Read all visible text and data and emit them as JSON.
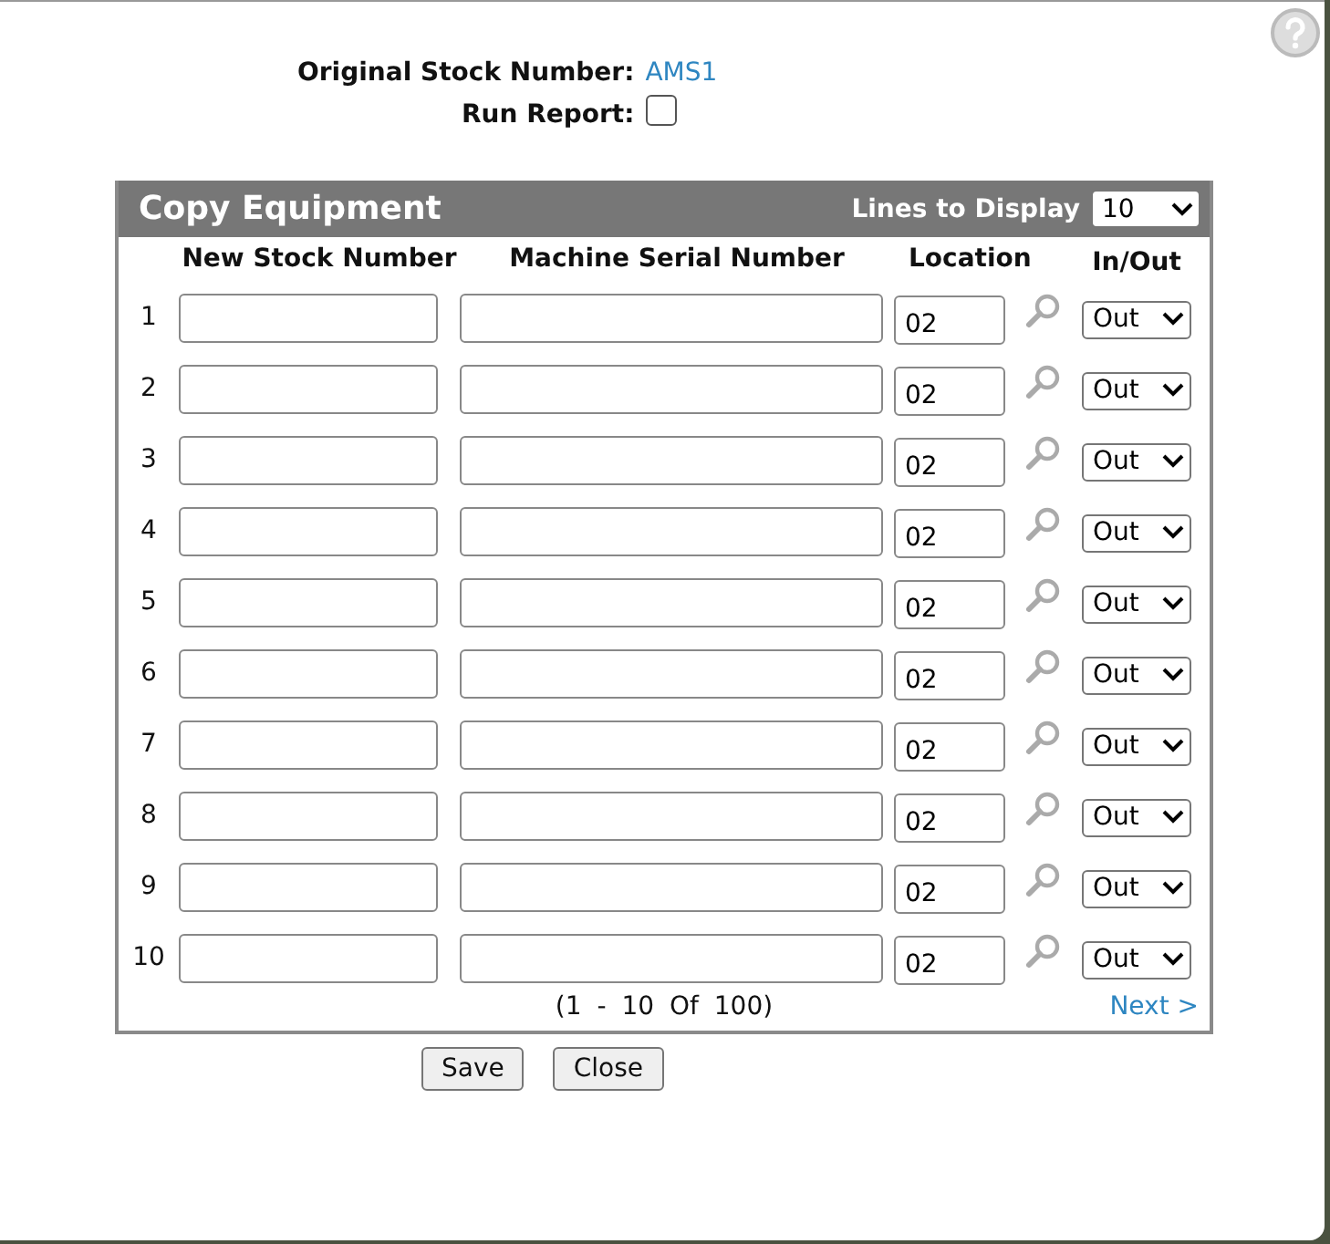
{
  "header": {
    "original_stock_label": "Original Stock Number:",
    "original_stock_value": "AMS1",
    "run_report_label": "Run Report:",
    "run_report_checked": false
  },
  "panel": {
    "title": "Copy Equipment",
    "lines_label": "Lines to Display",
    "lines_value": "10",
    "columns": [
      "New Stock Number",
      "Machine Serial Number",
      "Location",
      "In/Out"
    ],
    "rows": [
      {
        "number": "1",
        "new_stock": "",
        "serial": "",
        "location": "02",
        "in_out": "Out"
      },
      {
        "number": "2",
        "new_stock": "",
        "serial": "",
        "location": "02",
        "in_out": "Out"
      },
      {
        "number": "3",
        "new_stock": "",
        "serial": "",
        "location": "02",
        "in_out": "Out"
      },
      {
        "number": "4",
        "new_stock": "",
        "serial": "",
        "location": "02",
        "in_out": "Out"
      },
      {
        "number": "5",
        "new_stock": "",
        "serial": "",
        "location": "02",
        "in_out": "Out"
      },
      {
        "number": "6",
        "new_stock": "",
        "serial": "",
        "location": "02",
        "in_out": "Out"
      },
      {
        "number": "7",
        "new_stock": "",
        "serial": "",
        "location": "02",
        "in_out": "Out"
      },
      {
        "number": "8",
        "new_stock": "",
        "serial": "",
        "location": "02",
        "in_out": "Out"
      },
      {
        "number": "9",
        "new_stock": "",
        "serial": "",
        "location": "02",
        "in_out": "Out"
      },
      {
        "number": "10",
        "new_stock": "",
        "serial": "",
        "location": "02",
        "in_out": "Out"
      }
    ],
    "pagination": "(1 - 10 Of 100)",
    "next": "Next >"
  },
  "buttons": [
    "Save",
    "Close"
  ]
}
